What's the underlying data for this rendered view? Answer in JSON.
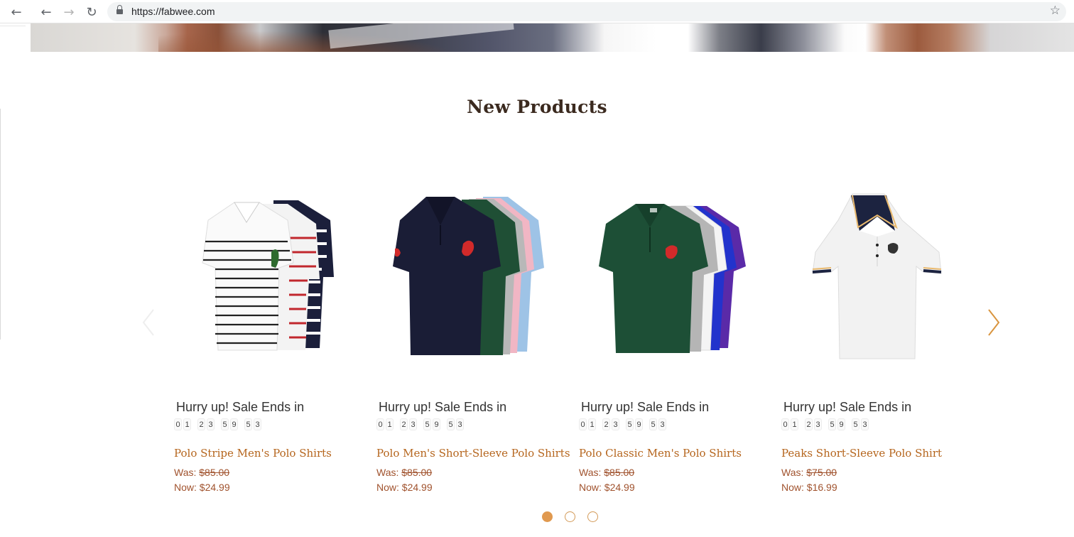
{
  "browser": {
    "back_icon": "arrow-left",
    "forward_icon": "arrow-right",
    "reload_icon": "reload",
    "url": "https://fabwee.com",
    "bookmark_icon": "star-outline"
  },
  "section": {
    "title": "New Products"
  },
  "carousel": {
    "prev_icon": "chevron-left",
    "next_icon": "chevron-right",
    "page_count": 3,
    "active_page": 1,
    "accent_color": "#e0994f"
  },
  "products": [
    {
      "image": "striped polo shirts (white/black, red stripes)",
      "hurry_text": "Hurry up! Sale Ends in",
      "countdown": [
        "0",
        "1",
        "2",
        "3",
        "5",
        "9",
        "5",
        "3"
      ],
      "title": "Polo Stripe Men's Polo Shirts",
      "was_label": "Was:",
      "was_price": "$85.00",
      "now_label": "Now:",
      "now_price": "$24.99"
    },
    {
      "image": "navy polo shirts stack",
      "hurry_text": "Hurry up! Sale Ends in",
      "countdown": [
        "0",
        "1",
        "2",
        "3",
        "5",
        "9",
        "5",
        "3"
      ],
      "title": "Polo Men's Short-Sleeve Polo Shirts",
      "was_label": "Was:",
      "was_price": "$85.00",
      "now_label": "Now:",
      "now_price": "$24.99"
    },
    {
      "image": "green polo shirts stack",
      "hurry_text": "Hurry up! Sale Ends in",
      "countdown": [
        "0",
        "1",
        "2",
        "3",
        "5",
        "9",
        "5",
        "3"
      ],
      "title": "Polo Classic Men's Polo Shirts",
      "was_label": "Was:",
      "was_price": "$85.00",
      "now_label": "Now:",
      "now_price": "$24.99"
    },
    {
      "image": "white polo shirt with navy collar",
      "hurry_text": "Hurry up! Sale Ends in",
      "countdown": [
        "0",
        "1",
        "2",
        "3",
        "5",
        "9",
        "5",
        "3"
      ],
      "title": "Peaks Short-Sleeve Polo Shirt",
      "was_label": "Was:",
      "was_price": "$75.00",
      "now_label": "Now:",
      "now_price": "$16.99"
    }
  ]
}
